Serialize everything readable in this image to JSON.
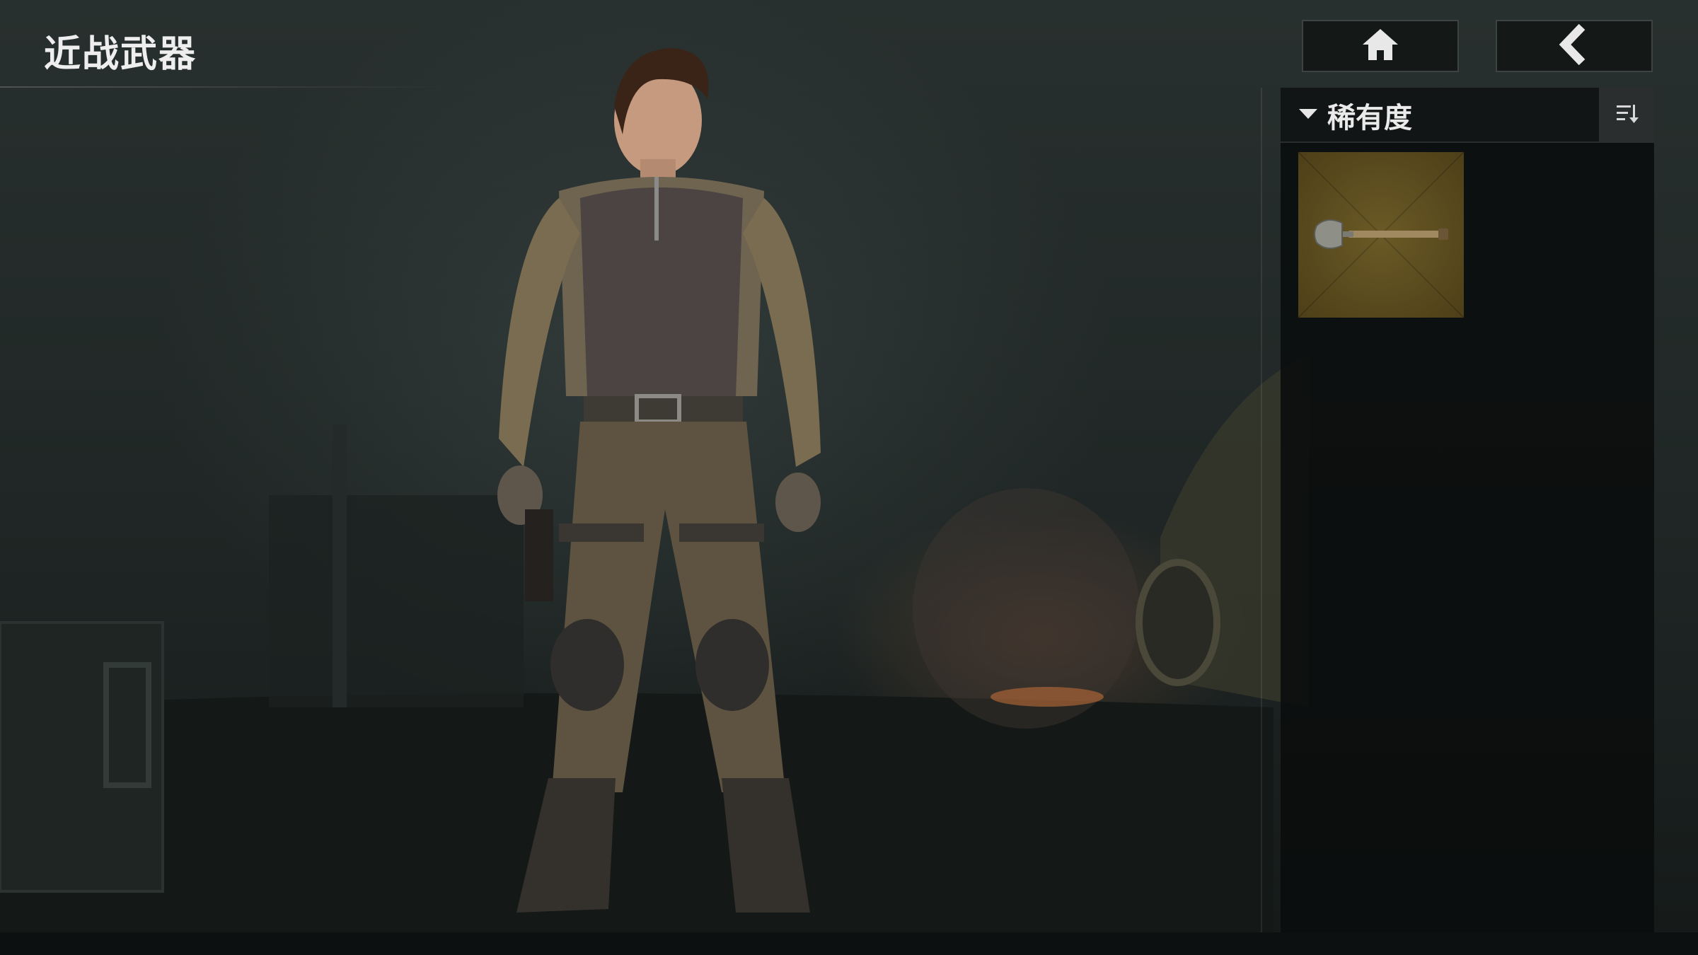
{
  "header": {
    "title": "近战武器"
  },
  "nav": {
    "home_icon": "home-icon",
    "back_icon": "back-arrow-icon"
  },
  "panel": {
    "filter_label": "稀有度",
    "filter_icon": "chevron-down-icon",
    "sort_icon": "sort-icon",
    "items": [
      {
        "icon": "shovel-icon",
        "rarity_color": "#5a4a1e"
      }
    ]
  },
  "colors": {
    "panel_bg": "#0a0c0c",
    "card_bg": "#5a4a1e",
    "text": "#eaeaea"
  }
}
